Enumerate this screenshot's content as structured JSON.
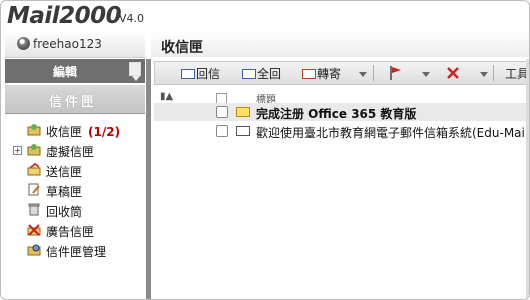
{
  "app": {
    "name": "Mail2000",
    "version": "V4.0"
  },
  "user": {
    "name": "freehao123"
  },
  "page_title": "收信匣",
  "sidebar": {
    "edit_label": "編輯",
    "folders_label": "信件匣",
    "items": [
      {
        "label": "收信匣",
        "count": "(1/2)",
        "icon": "inbox-icon"
      },
      {
        "label": "虛擬信匣",
        "count": "",
        "icon": "virtual-folder-icon",
        "expandable": true
      },
      {
        "label": "送信匣",
        "count": "",
        "icon": "sent-icon"
      },
      {
        "label": "草稿匣",
        "count": "",
        "icon": "draft-icon"
      },
      {
        "label": "回收筒",
        "count": "",
        "icon": "trash-icon"
      },
      {
        "label": "廣告信匣",
        "count": "",
        "icon": "spam-icon"
      },
      {
        "label": "信件匣管理",
        "count": "",
        "icon": "folder-manage-icon"
      }
    ]
  },
  "toolbar": {
    "reply": "回信",
    "reply_all": "全回",
    "forward": "轉寄",
    "tools": "工具"
  },
  "list": {
    "header_subject": "標題",
    "messages": [
      {
        "subject": "完成注册 Office 365 教育版",
        "unread": true
      },
      {
        "subject": "歡迎使用臺北市教育網電子郵件信箱系統(Edu-Mail)",
        "unread": false
      }
    ]
  },
  "colors": {
    "count": "#c00000",
    "sidebar_dark": "#6f6f6f",
    "selected_row": "#e9e9e9"
  }
}
